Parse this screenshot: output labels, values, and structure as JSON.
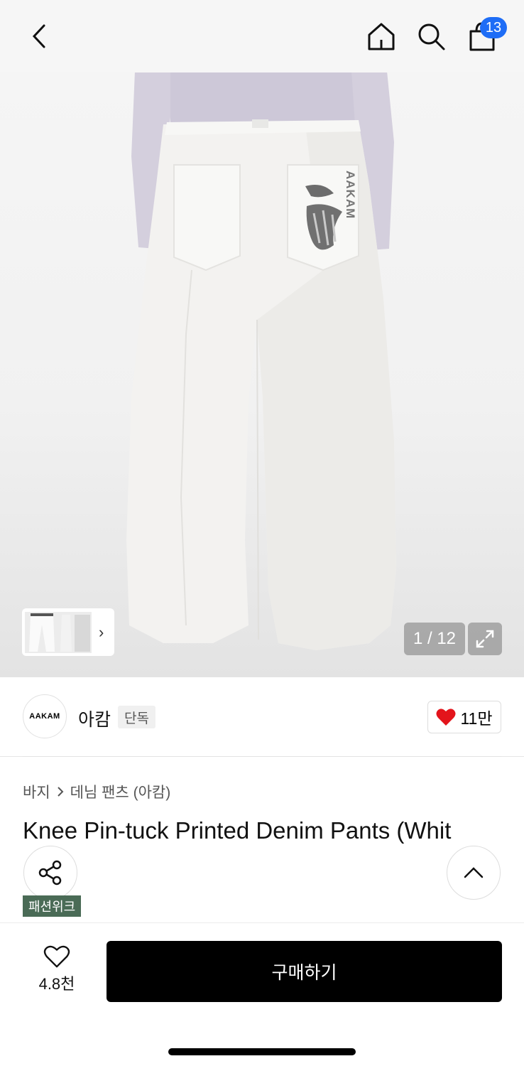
{
  "header": {
    "back_icon": "chevron-left-icon",
    "home_icon": "home-icon",
    "search_icon": "search-icon",
    "cart_icon": "shopping-bag-icon",
    "cart_count": "13",
    "badge_color": "#1e6df6"
  },
  "gallery": {
    "page_counter": "1 / 12",
    "zoom_icon": "expand-icon",
    "thumb_chevron": "›",
    "print_text": "AAKAM"
  },
  "brand": {
    "logo_text": "AAKAM",
    "name": "아캄",
    "tag": "단독",
    "like_count": "11만",
    "like_color": "#e3141b"
  },
  "product": {
    "breadcrumb": [
      "바지",
      "데님 팬츠 (아캄)"
    ],
    "title": "Knee Pin-tuck Printed Denim Pants (Whit",
    "event_badge": "패션위크"
  },
  "actions": {
    "share_icon": "share-icon",
    "scroll_top_icon": "chevron-up-icon",
    "wish_icon": "heart-outline-icon",
    "wish_count": "4.8천",
    "buy_label": "구매하기"
  }
}
